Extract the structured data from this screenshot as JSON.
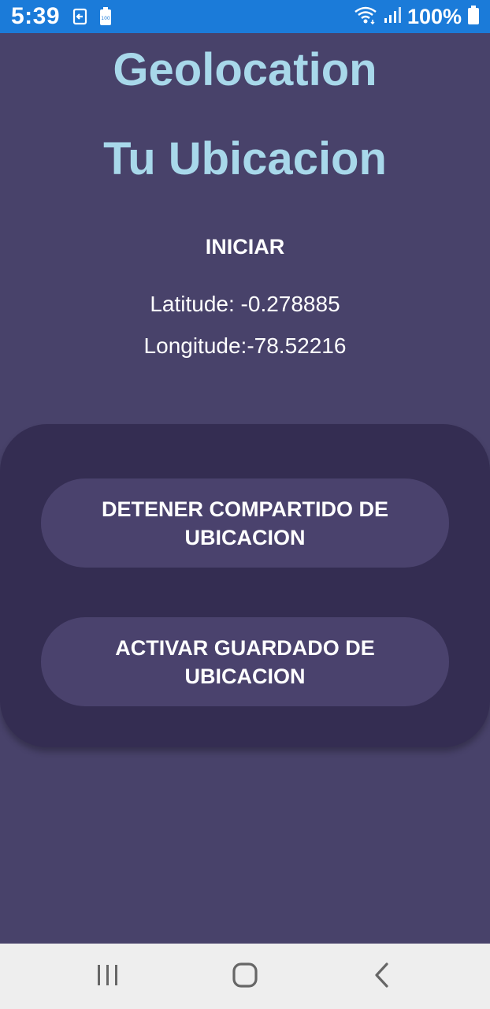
{
  "status_bar": {
    "time": "5:39",
    "battery_percent": "100%",
    "icons": [
      "screen-mirror-icon",
      "battery-saver-icon",
      "wifi-icon",
      "signal-icon",
      "battery-icon"
    ],
    "background_color": "#1b7bd9"
  },
  "app": {
    "title": "Geolocation",
    "subtitle": "Tu Ubicacion",
    "start_label": "INICIAR",
    "latitude": "Latitude: -0.278885",
    "longitude": "Longitude:-78.52216",
    "title_color": "#a8d8ea",
    "background_color": "#48426a"
  },
  "card": {
    "stop_sharing_label": "DETENER COMPARTIDO DE UBICACION",
    "activate_saving_label": "ACTIVAR GUARDADO DE UBICACION",
    "card_color": "#342d52",
    "button_color": "#4a426d"
  },
  "nav_bar": {
    "icons": [
      "recent-apps-icon",
      "home-icon",
      "back-icon"
    ]
  }
}
